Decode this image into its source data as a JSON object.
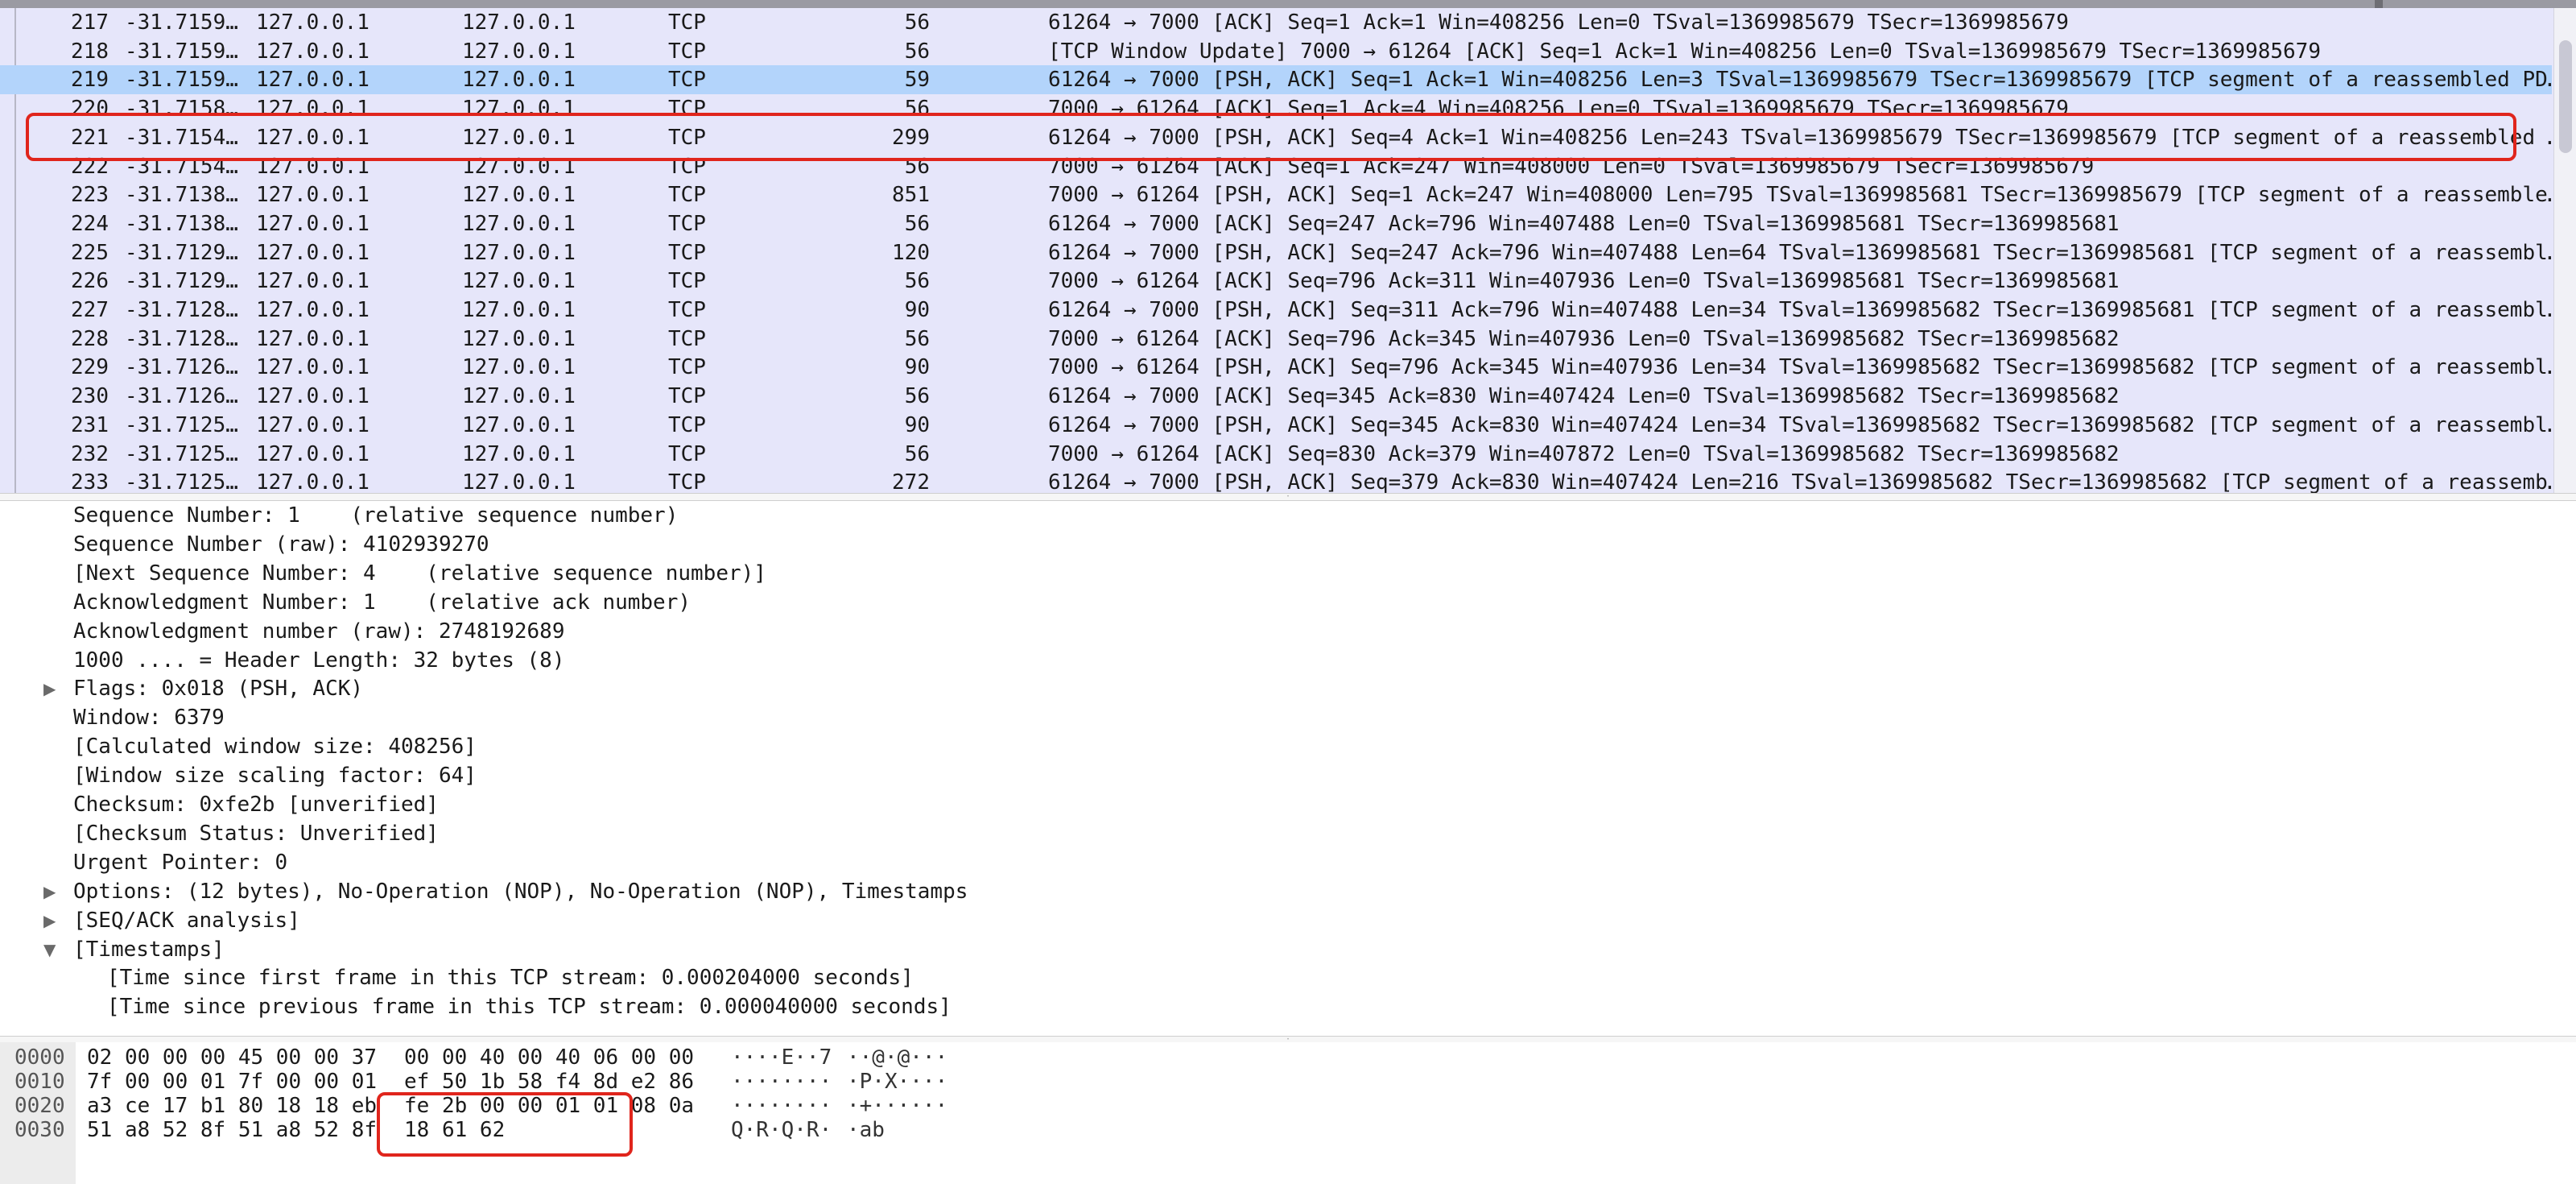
{
  "packet_list": {
    "selected_frame": "219",
    "rows": [
      {
        "no": "217",
        "time": "-31.7159…",
        "src": "127.0.0.1",
        "dst": "127.0.0.1",
        "proto": "TCP",
        "len": "56",
        "info": "61264 → 7000 [ACK] Seq=1 Ack=1 Win=408256 Len=0 TSval=1369985679 TSecr=1369985679"
      },
      {
        "no": "218",
        "time": "-31.7159…",
        "src": "127.0.0.1",
        "dst": "127.0.0.1",
        "proto": "TCP",
        "len": "56",
        "info": "[TCP Window Update] 7000 → 61264 [ACK] Seq=1 Ack=1 Win=408256 Len=0 TSval=1369985679 TSecr=1369985679"
      },
      {
        "no": "219",
        "time": "-31.7159…",
        "src": "127.0.0.1",
        "dst": "127.0.0.1",
        "proto": "TCP",
        "len": "59",
        "info": "61264 → 7000 [PSH, ACK] Seq=1 Ack=1 Win=408256 Len=3 TSval=1369985679 TSecr=1369985679 [TCP segment of a reassembled PD…"
      },
      {
        "no": "220",
        "time": "-31.7158…",
        "src": "127.0.0.1",
        "dst": "127.0.0.1",
        "proto": "TCP",
        "len": "56",
        "info": "7000 → 61264 [ACK] Seq=1 Ack=4 Win=408256 Len=0 TSval=1369985679 TSecr=1369985679"
      },
      {
        "no": "221",
        "time": "-31.7154…",
        "src": "127.0.0.1",
        "dst": "127.0.0.1",
        "proto": "TCP",
        "len": "299",
        "info": "61264 → 7000 [PSH, ACK] Seq=4 Ack=1 Win=408256 Len=243 TSval=1369985679 TSecr=1369985679 [TCP segment of a reassembled …"
      },
      {
        "no": "222",
        "time": "-31.7154…",
        "src": "127.0.0.1",
        "dst": "127.0.0.1",
        "proto": "TCP",
        "len": "56",
        "info": "7000 → 61264 [ACK] Seq=1 Ack=247 Win=408000 Len=0 TSval=1369985679 TSecr=1369985679"
      },
      {
        "no": "223",
        "time": "-31.7138…",
        "src": "127.0.0.1",
        "dst": "127.0.0.1",
        "proto": "TCP",
        "len": "851",
        "info": "7000 → 61264 [PSH, ACK] Seq=1 Ack=247 Win=408000 Len=795 TSval=1369985681 TSecr=1369985679 [TCP segment of a reassemble…"
      },
      {
        "no": "224",
        "time": "-31.7138…",
        "src": "127.0.0.1",
        "dst": "127.0.0.1",
        "proto": "TCP",
        "len": "56",
        "info": "61264 → 7000 [ACK] Seq=247 Ack=796 Win=407488 Len=0 TSval=1369985681 TSecr=1369985681"
      },
      {
        "no": "225",
        "time": "-31.7129…",
        "src": "127.0.0.1",
        "dst": "127.0.0.1",
        "proto": "TCP",
        "len": "120",
        "info": "61264 → 7000 [PSH, ACK] Seq=247 Ack=796 Win=407488 Len=64 TSval=1369985681 TSecr=1369985681 [TCP segment of a reassembl…"
      },
      {
        "no": "226",
        "time": "-31.7129…",
        "src": "127.0.0.1",
        "dst": "127.0.0.1",
        "proto": "TCP",
        "len": "56",
        "info": "7000 → 61264 [ACK] Seq=796 Ack=311 Win=407936 Len=0 TSval=1369985681 TSecr=1369985681"
      },
      {
        "no": "227",
        "time": "-31.7128…",
        "src": "127.0.0.1",
        "dst": "127.0.0.1",
        "proto": "TCP",
        "len": "90",
        "info": "61264 → 7000 [PSH, ACK] Seq=311 Ack=796 Win=407488 Len=34 TSval=1369985682 TSecr=1369985681 [TCP segment of a reassembl…"
      },
      {
        "no": "228",
        "time": "-31.7128…",
        "src": "127.0.0.1",
        "dst": "127.0.0.1",
        "proto": "TCP",
        "len": "56",
        "info": "7000 → 61264 [ACK] Seq=796 Ack=345 Win=407936 Len=0 TSval=1369985682 TSecr=1369985682"
      },
      {
        "no": "229",
        "time": "-31.7126…",
        "src": "127.0.0.1",
        "dst": "127.0.0.1",
        "proto": "TCP",
        "len": "90",
        "info": "7000 → 61264 [PSH, ACK] Seq=796 Ack=345 Win=407936 Len=34 TSval=1369985682 TSecr=1369985682 [TCP segment of a reassembl…"
      },
      {
        "no": "230",
        "time": "-31.7126…",
        "src": "127.0.0.1",
        "dst": "127.0.0.1",
        "proto": "TCP",
        "len": "56",
        "info": "61264 → 7000 [ACK] Seq=345 Ack=830 Win=407424 Len=0 TSval=1369985682 TSecr=1369985682"
      },
      {
        "no": "231",
        "time": "-31.7125…",
        "src": "127.0.0.1",
        "dst": "127.0.0.1",
        "proto": "TCP",
        "len": "90",
        "info": "61264 → 7000 [PSH, ACK] Seq=345 Ack=830 Win=407424 Len=34 TSval=1369985682 TSecr=1369985682 [TCP segment of a reassembl…"
      },
      {
        "no": "232",
        "time": "-31.7125…",
        "src": "127.0.0.1",
        "dst": "127.0.0.1",
        "proto": "TCP",
        "len": "56",
        "info": "7000 → 61264 [ACK] Seq=830 Ack=379 Win=407872 Len=0 TSval=1369985682 TSecr=1369985682"
      },
      {
        "no": "233",
        "time": "-31.7125…",
        "src": "127.0.0.1",
        "dst": "127.0.0.1",
        "proto": "TCP",
        "len": "272",
        "info": "61264 → 7000 [PSH, ACK] Seq=379 Ack=830 Win=407424 Len=216 TSval=1369985682 TSecr=1369985682 [TCP segment of a reassemb…"
      }
    ]
  },
  "detail_tree": {
    "rows": [
      {
        "text": "Sequence Number: 1    (relative sequence number)",
        "expander": "",
        "level": 0
      },
      {
        "text": "Sequence Number (raw): 4102939270",
        "expander": "",
        "level": 0
      },
      {
        "text": "[Next Sequence Number: 4    (relative sequence number)]",
        "expander": "",
        "level": 0
      },
      {
        "text": "Acknowledgment Number: 1    (relative ack number)",
        "expander": "",
        "level": 0
      },
      {
        "text": "Acknowledgment number (raw): 2748192689",
        "expander": "",
        "level": 0
      },
      {
        "text": "1000 .... = Header Length: 32 bytes (8)",
        "expander": "",
        "level": 0
      },
      {
        "text": "Flags: 0x018 (PSH, ACK)",
        "expander": "▶",
        "level": 0
      },
      {
        "text": "Window: 6379",
        "expander": "",
        "level": 0
      },
      {
        "text": "[Calculated window size: 408256]",
        "expander": "",
        "level": 0
      },
      {
        "text": "[Window size scaling factor: 64]",
        "expander": "",
        "level": 0
      },
      {
        "text": "Checksum: 0xfe2b [unverified]",
        "expander": "",
        "level": 0
      },
      {
        "text": "[Checksum Status: Unverified]",
        "expander": "",
        "level": 0
      },
      {
        "text": "Urgent Pointer: 0",
        "expander": "",
        "level": 0
      },
      {
        "text": "Options: (12 bytes), No-Operation (NOP), No-Operation (NOP), Timestamps",
        "expander": "▶",
        "level": 0
      },
      {
        "text": "[SEQ/ACK analysis]",
        "expander": "▶",
        "level": 0
      },
      {
        "text": "[Timestamps]",
        "expander": "▼",
        "level": 0
      },
      {
        "text": "[Time since first frame in this TCP stream: 0.000204000 seconds]",
        "expander": "",
        "level": 1
      },
      {
        "text": "[Time since previous frame in this TCP stream: 0.000040000 seconds]",
        "expander": "",
        "level": 1
      }
    ]
  },
  "bytes_pane": {
    "rows": [
      {
        "offset": "0000",
        "hex1": "02 00 00 00 45 00 00 37",
        "hex2": "00 00 40 00 40 06 00 00",
        "ascii1": "····E··7",
        "ascii2": "··@·@···"
      },
      {
        "offset": "0010",
        "hex1": "7f 00 00 01 7f 00 00 01",
        "hex2": "ef 50 1b 58 f4 8d e2 86",
        "ascii1": "········",
        "ascii2": "·P·X····"
      },
      {
        "offset": "0020",
        "hex1": "a3 ce 17 b1 80 18 18 eb",
        "hex2": "fe 2b 00 00 01 01 08 0a",
        "ascii1": "········",
        "ascii2": "·+······"
      },
      {
        "offset": "0030",
        "hex1": "51 a8 52 8f 51 a8 52 8f",
        "hex2": "18 61 62",
        "ascii1": "Q·R·Q·R·",
        "ascii2": "·ab"
      }
    ]
  },
  "colors": {
    "row_background": "#e6e6fa",
    "selected_row": "#b3d4fb",
    "annotation_red": "#e0251c"
  },
  "icons": {
    "collapsed": "triangle-right-icon",
    "expanded": "triangle-down-icon"
  }
}
